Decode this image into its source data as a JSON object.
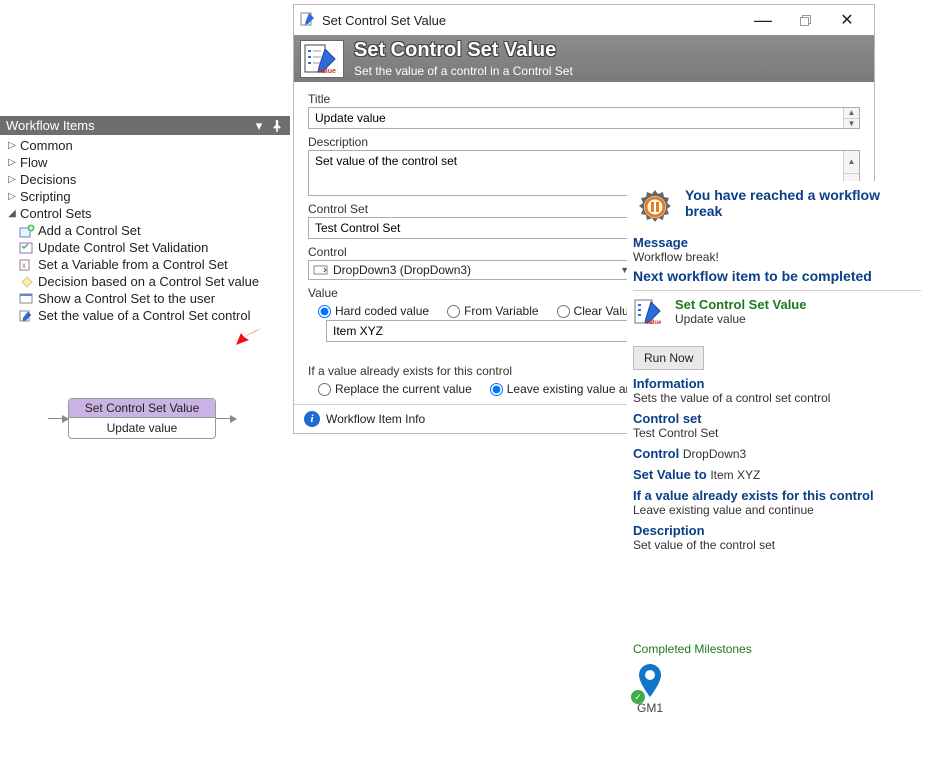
{
  "panel": {
    "title": "Workflow Items",
    "groups": {
      "common": "Common",
      "flow": "Flow",
      "decisions": "Decisions",
      "scripting": "Scripting",
      "control_sets": "Control Sets"
    },
    "items": {
      "add": "Add a Control Set",
      "update_validation": "Update Control Set Validation",
      "set_var": "Set a Variable from a Control Set",
      "decision": "Decision based on a Control Set value",
      "show": "Show a Control Set to the user",
      "set_value": "Set the value of a Control Set control"
    }
  },
  "node": {
    "title": "Set Control Set Value",
    "sub": "Update value"
  },
  "dialog": {
    "window_title": "Set Control Set Value",
    "banner_title": "Set Control Set Value",
    "banner_sub": "Set the value of a control in a Control Set",
    "labels": {
      "title": "Title",
      "description": "Description",
      "control_set": "Control Set",
      "control": "Control",
      "value": "Value",
      "hard_coded": "Hard coded value",
      "from_variable": "From Variable",
      "clear_value": "Clear Value",
      "exists_heading": "If a value already exists for this control",
      "replace": "Replace the current value",
      "leave": "Leave existing value and continue"
    },
    "values": {
      "title": "Update value",
      "description": "Set value of the control set",
      "control_set": "Test Control Set",
      "control": "DropDown3 (DropDown3)",
      "value": "Item XYZ"
    },
    "footer": "Workflow Item Info"
  },
  "help": {
    "break_title": "You have reached a workflow break",
    "message_label": "Message",
    "message_text": "Workflow break!",
    "next_label": "Next workflow item to be completed",
    "next_link": "Set Control Set Value",
    "next_sub": "Update value",
    "run_now": "Run Now",
    "info_label": "Information",
    "info_text": "Sets the value of a control set control",
    "cs_label": "Control set",
    "cs_text": "Test Control Set",
    "control_label": "Control",
    "control_text": "DropDown3",
    "setvalue_label": "Set Value to",
    "setvalue_text": "Item XYZ",
    "exists_label": "If a value already exists for this control",
    "exists_text": "Leave existing value and continue",
    "desc_label": "Description",
    "desc_text": "Set value of the control set",
    "milestones_label": "Completed Milestones",
    "milestone_name": "GM1"
  }
}
